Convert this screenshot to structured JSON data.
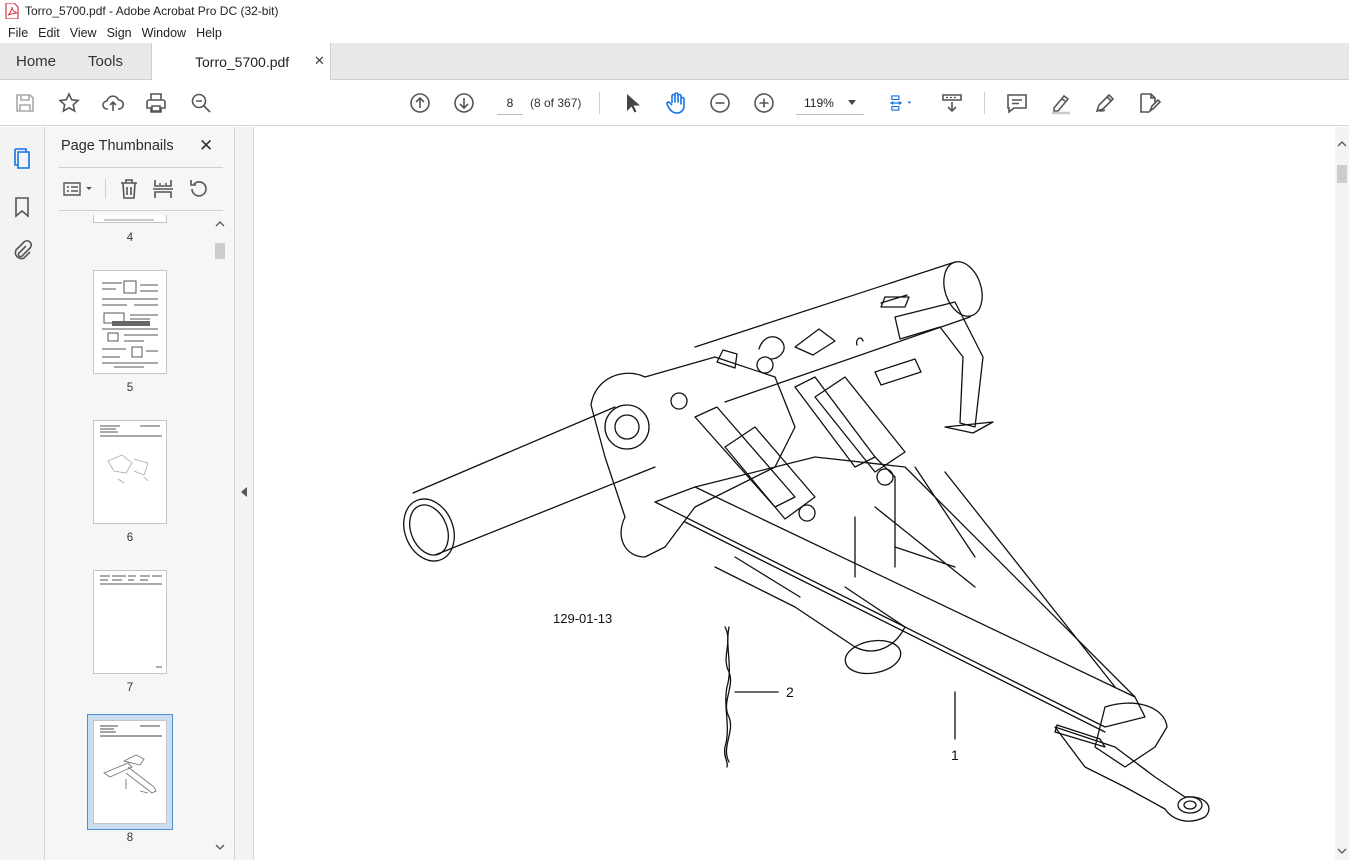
{
  "window": {
    "title": "Torro_5700.pdf - Adobe Acrobat Pro DC (32-bit)"
  },
  "menu": {
    "items": [
      "File",
      "Edit",
      "View",
      "Sign",
      "Window",
      "Help"
    ]
  },
  "tabs": {
    "home": "Home",
    "tools": "Tools",
    "document": "Torro_5700.pdf",
    "close": "✕"
  },
  "toolbar": {
    "page_number": "8",
    "page_count": "(8 of 367)",
    "zoom": "119%"
  },
  "panel": {
    "title": "Page Thumbnails",
    "close": "✕",
    "thumbnails": [
      {
        "label": "4"
      },
      {
        "label": "5"
      },
      {
        "label": "6"
      },
      {
        "label": "7"
      },
      {
        "label": "8",
        "selected": true
      }
    ]
  },
  "document": {
    "figure_id": "129-01-13",
    "callouts": [
      "1",
      "2"
    ]
  },
  "colors": {
    "accent": "#1473e6",
    "pdf_red": "#d7373f",
    "selection": "#c9def1"
  }
}
